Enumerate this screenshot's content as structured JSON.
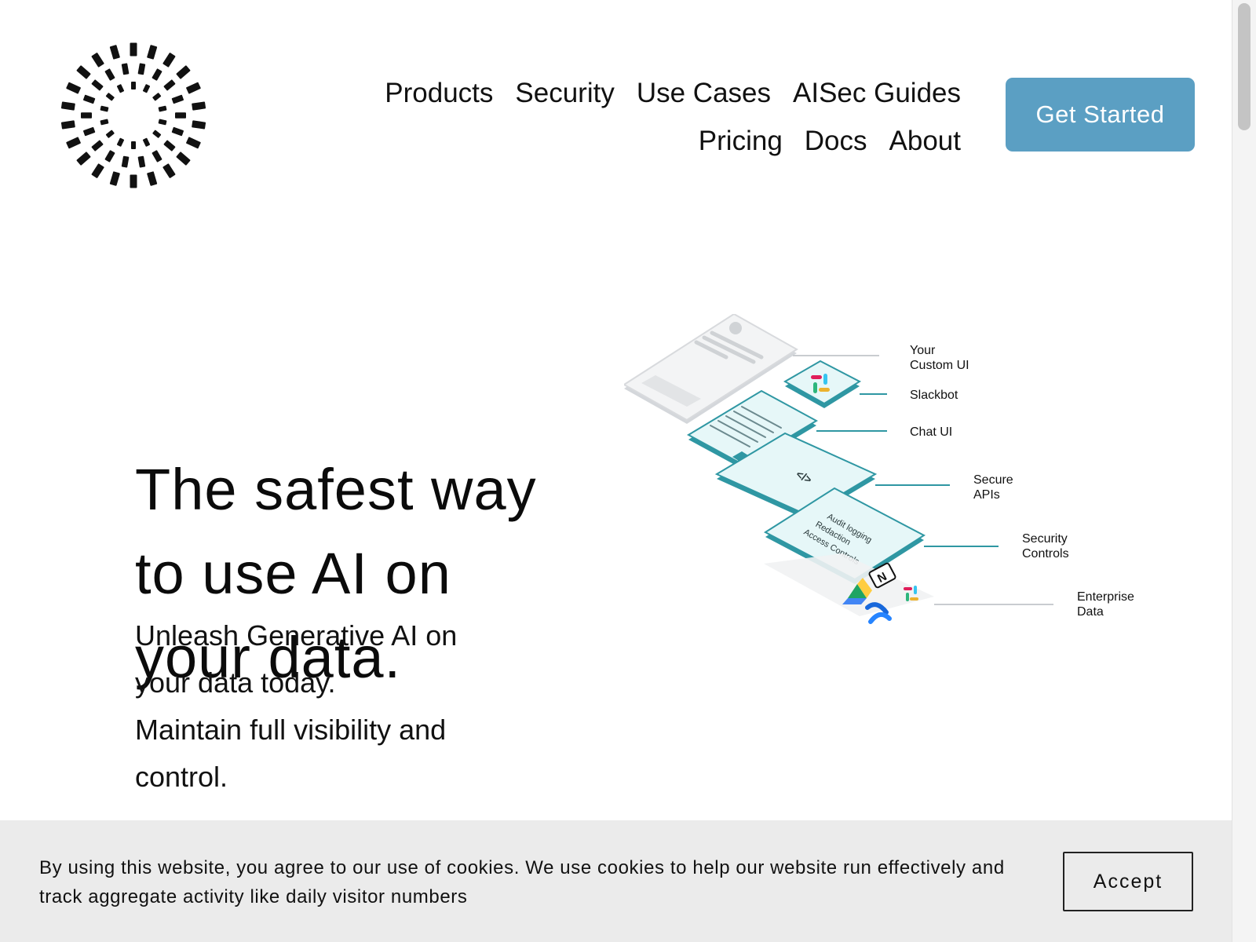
{
  "header": {
    "nav_items": [
      "Products",
      "Security",
      "Use Cases",
      "AISec Guides",
      "Pricing",
      "Docs",
      "About"
    ],
    "cta_label": "Get Started"
  },
  "hero": {
    "title_lines": [
      "The safest way",
      "to use AI on",
      "your data."
    ],
    "subtitle_lines": [
      "Unleash Generative AI on",
      "your data today.",
      "Maintain full visibility and",
      "control."
    ]
  },
  "diagram": {
    "labels": {
      "custom_ui": [
        "Your",
        "Custom UI"
      ],
      "slackbot": "Slackbot",
      "chat_ui": "Chat UI",
      "secure_apis": [
        "Secure",
        "APIs"
      ],
      "security_controls": [
        "Security",
        "Controls"
      ],
      "enterprise_data": [
        "Enterprise",
        "Data"
      ]
    },
    "control_items": [
      "Audit logging",
      "Redaction",
      "Access Controls"
    ],
    "accent_color": "#2f97a3",
    "layer_fill": "#e6f7f8"
  },
  "cookie_banner": {
    "text": "By using this website, you agree to our use of cookies. We use cookies to help our website run effectively and  track aggregate activity like daily visitor numbers",
    "accept_label": "Accept"
  },
  "colors": {
    "cta_background": "#5b9fc3",
    "cookie_background": "#ebebeb"
  }
}
